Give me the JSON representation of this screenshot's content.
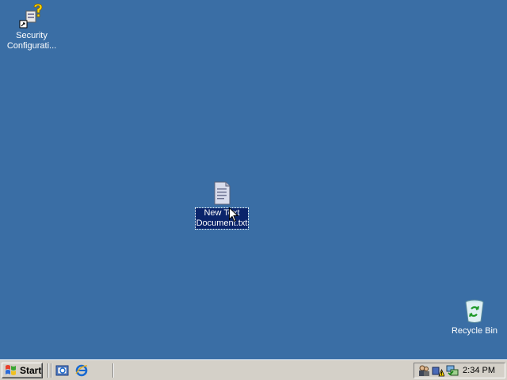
{
  "desktop": {
    "background": "#3a6ea5",
    "icons": [
      {
        "label": "Security\nConfigurati...",
        "icon": "security-config-shortcut-icon",
        "selected": false
      },
      {
        "label": "New Text\nDocument.txt",
        "icon": "text-document-icon",
        "selected": true
      },
      {
        "label": "Recycle Bin",
        "icon": "recycle-bin-icon",
        "selected": false
      }
    ]
  },
  "taskbar": {
    "start_label": "Start",
    "quick_launch": [
      "show-desktop-icon",
      "internet-explorer-icon"
    ],
    "tray_icons": [
      "network-users-icon",
      "security-warning-icon",
      "network-connection-icon"
    ],
    "clock": "2:34 PM"
  }
}
